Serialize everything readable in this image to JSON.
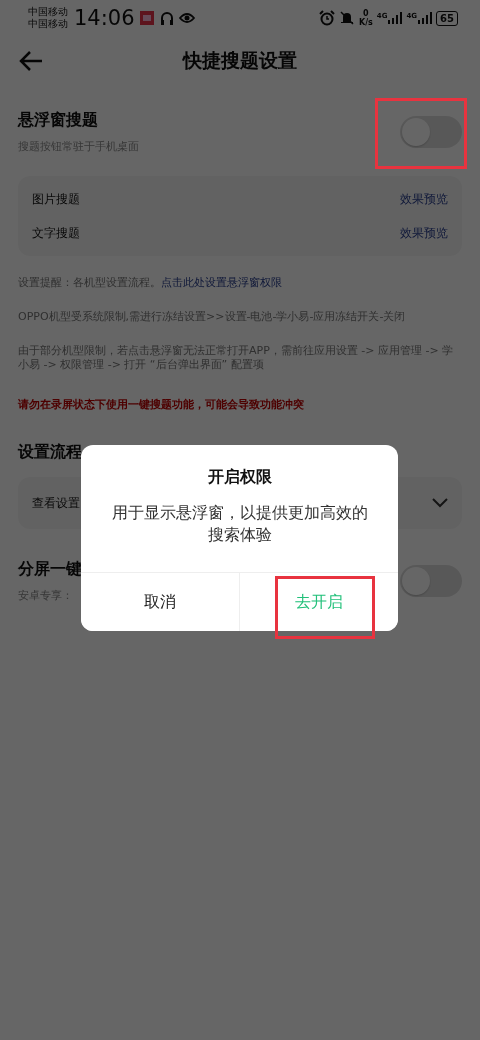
{
  "status_bar": {
    "carriers": [
      "中国移动",
      "中国移动"
    ],
    "time": "14:06",
    "speed_value": "0",
    "speed_unit": "K/s",
    "network_labels": [
      "4G",
      "4G"
    ],
    "battery": "65"
  },
  "header": {
    "title": "快捷搜题设置"
  },
  "floating_search": {
    "title": "悬浮窗搜题",
    "subtitle": "搜题按钮常驻于手机桌面",
    "on": false,
    "options": [
      {
        "label": "图片搜题",
        "action": "效果预览"
      },
      {
        "label": "文字搜题",
        "action": "效果预览"
      }
    ]
  },
  "notes": {
    "reminder": "设置提醒：各机型设置流程。",
    "reminder_link": "点击此处设置悬浮窗权限",
    "oppo": "OPPO机型受系统限制,需进行冻结设置>>设置-电池-学小易-应用冻结开关-关闭",
    "limit": "由于部分机型限制，若点击悬浮窗无法正常打开APP，需前往应用设置 -> 应用管理 -> 学小易 -> 权限管理 -> 打开 “后台弹出界面” 配置项",
    "warning": "请勿在录屏状态下使用一键搜题功能，可能会导致功能冲突"
  },
  "setup_flow": {
    "title": "设置流程",
    "dropdown": "查看设置",
    "expanded": false
  },
  "split_screen": {
    "title": "分屏一键",
    "subtitle": "安卓专享：",
    "on": false
  },
  "dialog": {
    "title": "开启权限",
    "message": "用于显示悬浮窗，以提供更加高效的搜索体验",
    "buttons": [
      "取消",
      "去开启"
    ]
  }
}
